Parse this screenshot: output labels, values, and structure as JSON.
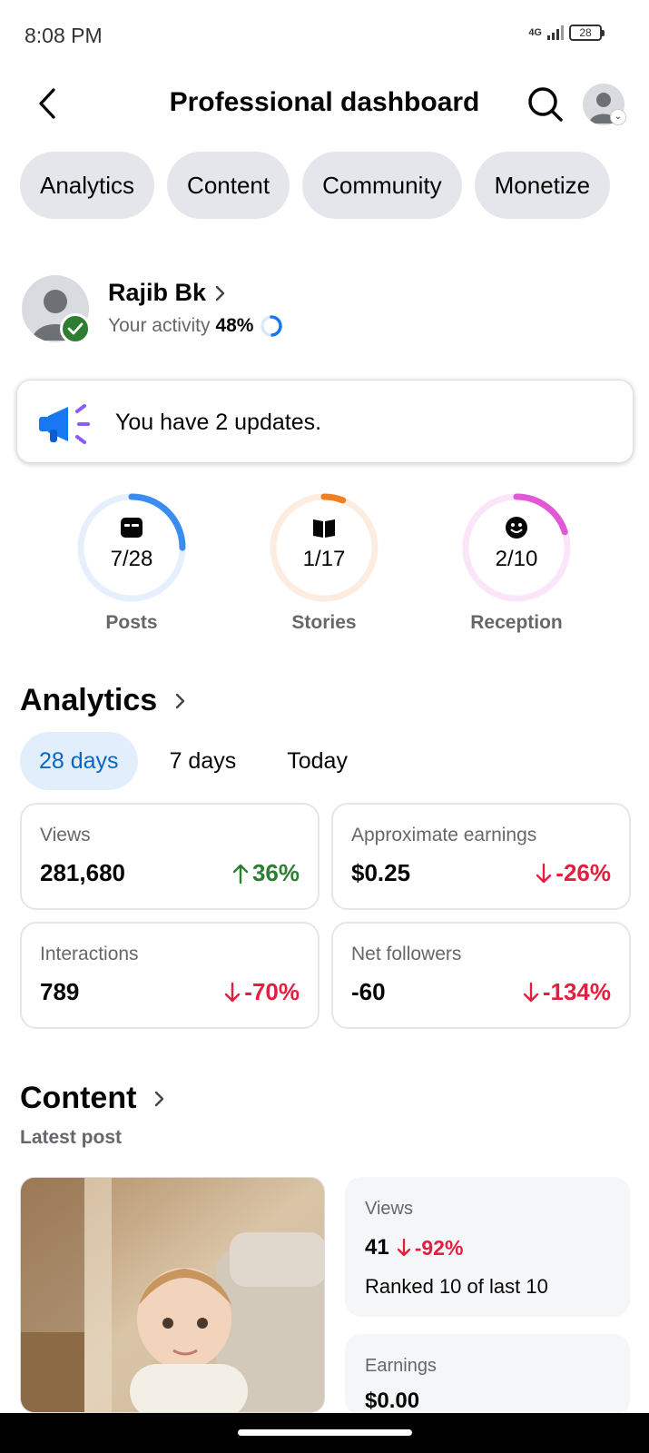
{
  "status_bar": {
    "time": "8:08 PM",
    "network": "4G",
    "battery": "28"
  },
  "header": {
    "title": "Professional dashboard"
  },
  "tabs": [
    "Analytics",
    "Content",
    "Community",
    "Monetize"
  ],
  "profile": {
    "name": "Rajib Bk",
    "activity_label": "Your activity",
    "activity_value": "48%",
    "activity_progress": 0.48
  },
  "updates": {
    "text": "You have 2 updates."
  },
  "rings": [
    {
      "label": "Posts",
      "value": "7/28",
      "progress": 0.25,
      "color": "#3b8cf0",
      "track": "#e6f0fd",
      "icon": "post-icon"
    },
    {
      "label": "Stories",
      "value": "1/17",
      "progress": 0.06,
      "color": "#f07f22",
      "track": "#fdece0",
      "icon": "book-icon"
    },
    {
      "label": "Reception",
      "value": "2/10",
      "progress": 0.2,
      "color": "#e257d6",
      "track": "#fbe6f9",
      "icon": "smiley-icon"
    }
  ],
  "analytics": {
    "title": "Analytics",
    "periods": [
      "28 days",
      "7 days",
      "Today"
    ],
    "active_period": "28 days",
    "metrics": [
      {
        "label": "Views",
        "value": "281,680",
        "change": "36%",
        "direction": "up"
      },
      {
        "label": "Approximate earnings",
        "value": "$0.25",
        "change": "-26%",
        "direction": "down"
      },
      {
        "label": "Interactions",
        "value": "789",
        "change": "-70%",
        "direction": "down"
      },
      {
        "label": "Net followers",
        "value": "-60",
        "change": "-134%",
        "direction": "down"
      }
    ]
  },
  "content": {
    "title": "Content",
    "latest_label": "Latest post",
    "views_label": "Views",
    "views_value": "41",
    "views_change": "-92%",
    "rank_text": "Ranked 10 of last 10",
    "earnings_label": "Earnings",
    "earnings_value": "$0.00"
  },
  "colors": {
    "accent": "#0a66c2",
    "positive": "#2e7d32",
    "negative": "#e41e3f",
    "chip_bg": "#e4e6eb"
  }
}
